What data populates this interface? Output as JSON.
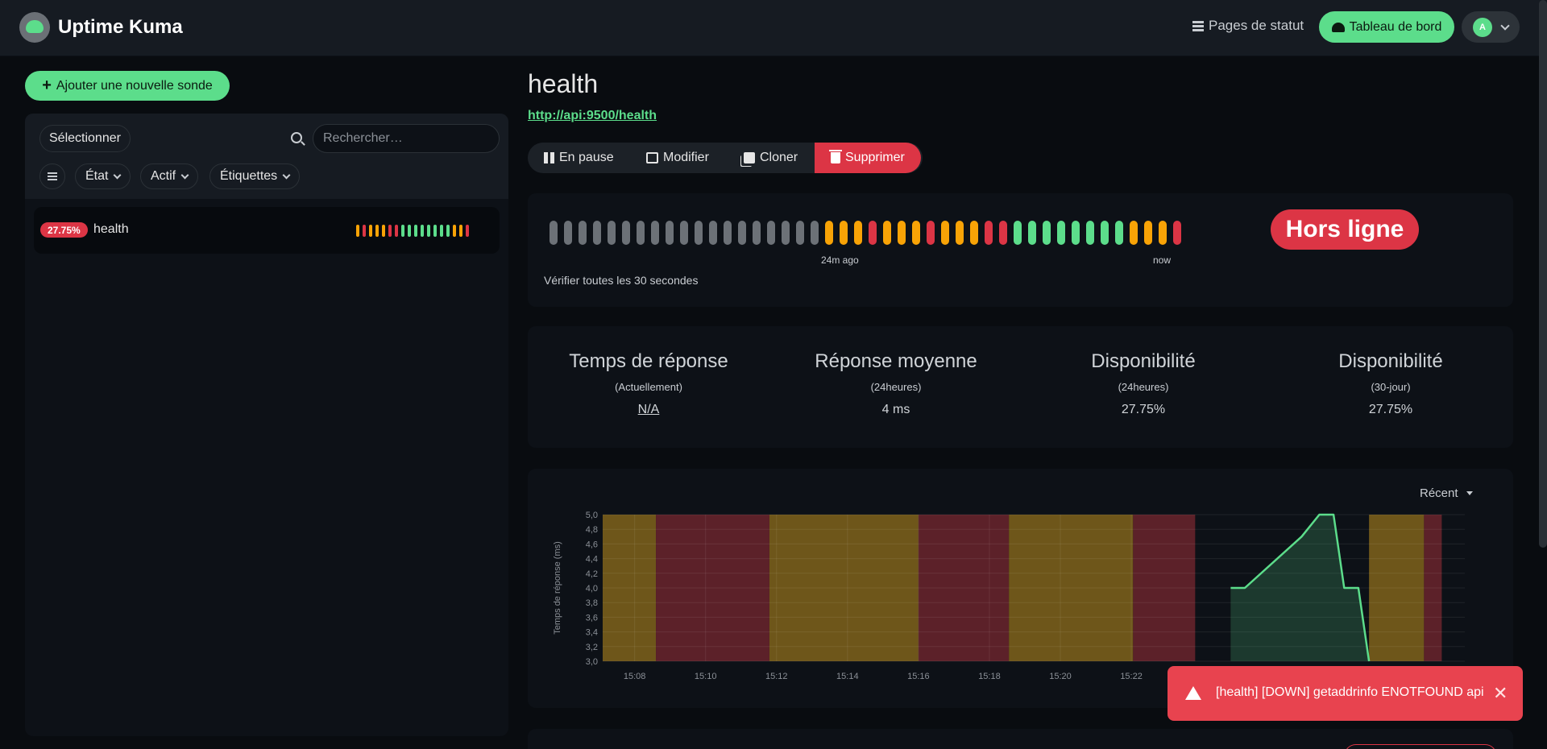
{
  "app": {
    "name": "Uptime Kuma"
  },
  "nav": {
    "status_pages": "Pages de statut",
    "dashboard": "Tableau de bord",
    "avatar_letter": "A"
  },
  "sidebar": {
    "add_button": "Ajouter une nouvelle sonde",
    "select_button": "Sélectionner",
    "search_placeholder": "Rechercher…",
    "filters": [
      "État",
      "Actif",
      "Étiquettes"
    ],
    "monitors": [
      {
        "name": "health",
        "uptime": "27.75%",
        "beats": [
          "orange",
          "red",
          "orange",
          "orange",
          "orange",
          "red",
          "red",
          "green",
          "green",
          "green",
          "green",
          "green",
          "green",
          "green",
          "green",
          "orange",
          "orange",
          "red"
        ]
      }
    ]
  },
  "monitor": {
    "title": "health",
    "url": "http://api:9500/health",
    "actions": {
      "pause": "En pause",
      "edit": "Modifier",
      "clone": "Cloner",
      "delete": "Supprimer"
    },
    "heartbeat": {
      "beats": [
        "gray",
        "gray",
        "gray",
        "gray",
        "gray",
        "gray",
        "gray",
        "gray",
        "gray",
        "gray",
        "gray",
        "gray",
        "gray",
        "gray",
        "gray",
        "gray",
        "gray",
        "gray",
        "gray",
        "orange",
        "orange",
        "orange",
        "red",
        "orange",
        "orange",
        "orange",
        "red",
        "orange",
        "orange",
        "orange",
        "red",
        "red",
        "green",
        "green",
        "green",
        "green",
        "green",
        "green",
        "green",
        "green",
        "orange",
        "orange",
        "orange",
        "red"
      ],
      "label_start": "24m ago",
      "label_end": "now",
      "interval_text": "Vérifier toutes les 30 secondes"
    },
    "status": "Hors ligne",
    "stats": [
      {
        "title": "Temps de réponse",
        "sub": "(Actuellement)",
        "value": "N/A"
      },
      {
        "title": "Réponse moyenne",
        "sub": "(24heures)",
        "value": "4 ms"
      },
      {
        "title": "Disponibilité",
        "sub": "(24heures)",
        "value": "27.75%"
      },
      {
        "title": "Disponibilité",
        "sub": "(30-jour)",
        "value": "27.75%"
      }
    ],
    "range_select": "Récent"
  },
  "colors": {
    "green": "#5cdd8b",
    "orange": "#f8a306",
    "red": "#dc3545",
    "gray": "#6c7177",
    "band_orange": "#6e561a",
    "band_red": "#5c2129"
  },
  "chart_data": {
    "type": "line",
    "ylabel": "Temps de réponse (ms)",
    "ylim": [
      3.0,
      5.0
    ],
    "y_ticks": [
      "5,0",
      "4,8",
      "4,6",
      "4,4",
      "4,2",
      "4,0",
      "3,8",
      "3,6",
      "3,4",
      "3,2",
      "3,0"
    ],
    "x_ticks": [
      "15:08",
      "15:10",
      "15:12",
      "15:14",
      "15:16",
      "15:18",
      "15:20",
      "15:22"
    ],
    "x_range_minutes": [
      7.1,
      31.4
    ],
    "bands": [
      {
        "status": "pending",
        "from": 7.1,
        "to": 8.6
      },
      {
        "status": "down",
        "from": 8.6,
        "to": 11.8
      },
      {
        "status": "pending",
        "from": 11.8,
        "to": 16.0
      },
      {
        "status": "down",
        "from": 16.0,
        "to": 18.55
      },
      {
        "status": "pending",
        "from": 18.55,
        "to": 22.05
      },
      {
        "status": "down",
        "from": 22.05,
        "to": 23.8
      },
      {
        "status": "pending",
        "from": 28.7,
        "to": 30.25
      },
      {
        "status": "down",
        "from": 30.25,
        "to": 30.75
      }
    ],
    "series": [
      {
        "values": [
          [
            24.8,
            4.0
          ],
          [
            25.2,
            4.0
          ],
          [
            26.8,
            4.7
          ],
          [
            27.3,
            5.0
          ],
          [
            27.7,
            5.0
          ],
          [
            28.0,
            4.0
          ],
          [
            28.4,
            4.0
          ],
          [
            28.7,
            3.0
          ]
        ]
      }
    ]
  },
  "toast": {
    "message": "[health] [DOWN] getaddrinfo ENOTFOUND api"
  }
}
